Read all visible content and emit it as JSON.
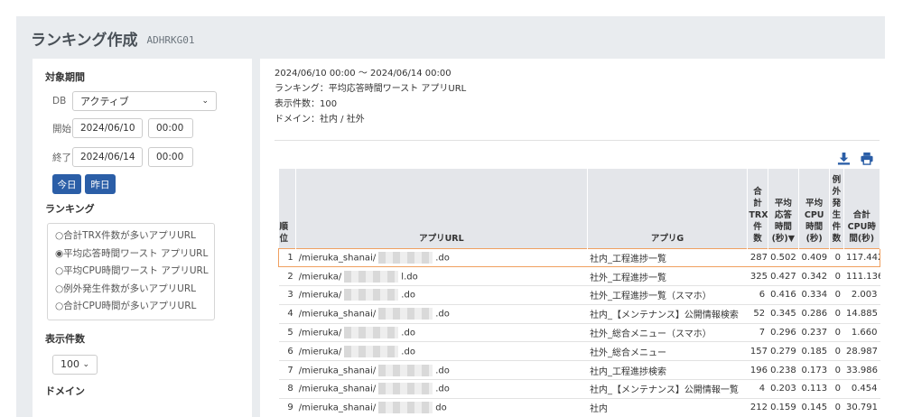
{
  "header": {
    "title": "ランキング作成",
    "code": "ADHRKG01"
  },
  "sidebar": {
    "period_label": "対象期間",
    "db_label": "DB",
    "db_value": "アクティブ",
    "start_label": "開始",
    "start_date": "2024/06/10",
    "start_time": "00:00",
    "end_label": "終了",
    "end_date": "2024/06/14",
    "end_time": "00:00",
    "today_button": "今日",
    "yesterday_button": "昨日",
    "ranking_label": "ランキング",
    "ranking_options": [
      "○合計TRX件数が多いアプリURL",
      "◉平均応答時間ワースト アプリURL",
      "○平均CPU時間ワースト アプリURL",
      "○例外発生件数が多いアプリURL",
      "○合計CPU時間が多いアプリURL"
    ],
    "display_count_label": "表示件数",
    "display_count_value": "100",
    "domain_label": "ドメイン"
  },
  "summary": {
    "period": "2024/06/10 00:00 ～ 2024/06/14 00:00",
    "ranking": "ランキング：平均応答時間ワースト アプリURL",
    "count": "表示件数：100",
    "domain": "ドメイン：社内 / 社外"
  },
  "table": {
    "headers": {
      "rank": "順\n位",
      "url": "アプリURL",
      "app": "アプリG",
      "trx": "合\n計\nTRX\n件\n数",
      "avg_resp": "平均\n応答\n時間\n(秒)▼",
      "avg_cpu": "平均\nCPU\n時間\n(秒)",
      "exc": "例\n外\n発\n生\n件\n数",
      "total_cpu": "合計\nCPU時\n間(秒)"
    },
    "rows": [
      {
        "rank": "1",
        "url_pre": "/mieruka_shanai/",
        "url_post": ".do",
        "app": "社内_工程進捗一覧",
        "trx": "287",
        "avg_resp": "0.502",
        "avg_cpu": "0.409",
        "exc": "0",
        "total_cpu": "117.442"
      },
      {
        "rank": "2",
        "url_pre": "/mieruka/",
        "url_post": "l.do",
        "app": "社外_工程進捗一覧",
        "trx": "325",
        "avg_resp": "0.427",
        "avg_cpu": "0.342",
        "exc": "0",
        "total_cpu": "111.136"
      },
      {
        "rank": "3",
        "url_pre": "/mieruka/",
        "url_post": ".do",
        "app": "社外_工程進捗一覧（スマホ）",
        "trx": "6",
        "avg_resp": "0.416",
        "avg_cpu": "0.334",
        "exc": "0",
        "total_cpu": "2.003"
      },
      {
        "rank": "4",
        "url_pre": "/mieruka_shanai/",
        "url_post": ".do",
        "app": "社内_【メンテナンス】公開情報検索",
        "trx": "52",
        "avg_resp": "0.345",
        "avg_cpu": "0.286",
        "exc": "0",
        "total_cpu": "14.885"
      },
      {
        "rank": "5",
        "url_pre": "/mieruka/",
        "url_post": ".do",
        "app": "社外_総合メニュー（スマホ）",
        "trx": "7",
        "avg_resp": "0.296",
        "avg_cpu": "0.237",
        "exc": "0",
        "total_cpu": "1.660"
      },
      {
        "rank": "6",
        "url_pre": "/mieruka/",
        "url_post": ".do",
        "app": "社外_総合メニュー",
        "trx": "157",
        "avg_resp": "0.279",
        "avg_cpu": "0.185",
        "exc": "0",
        "total_cpu": "28.987"
      },
      {
        "rank": "7",
        "url_pre": "/mieruka_shanai/",
        "url_post": ".do",
        "app": "社内_工程進捗検索",
        "trx": "196",
        "avg_resp": "0.238",
        "avg_cpu": "0.173",
        "exc": "0",
        "total_cpu": "33.986"
      },
      {
        "rank": "8",
        "url_pre": "/mieruka_shanai/",
        "url_post": ".do",
        "app": "社内_【メンテナンス】公開情報一覧",
        "trx": "4",
        "avg_resp": "0.203",
        "avg_cpu": "0.113",
        "exc": "0",
        "total_cpu": "0.454"
      },
      {
        "rank": "9",
        "url_pre": "/mieruka_shanai/",
        "url_post": "do",
        "app": "社内",
        "trx": "212",
        "avg_resp": "0.159",
        "avg_cpu": "0.145",
        "exc": "0",
        "total_cpu": "30.791"
      }
    ]
  },
  "toolbar": {
    "download_icon": "download-icon",
    "print_icon": "print-icon",
    "accent": "#2b5ea7"
  }
}
